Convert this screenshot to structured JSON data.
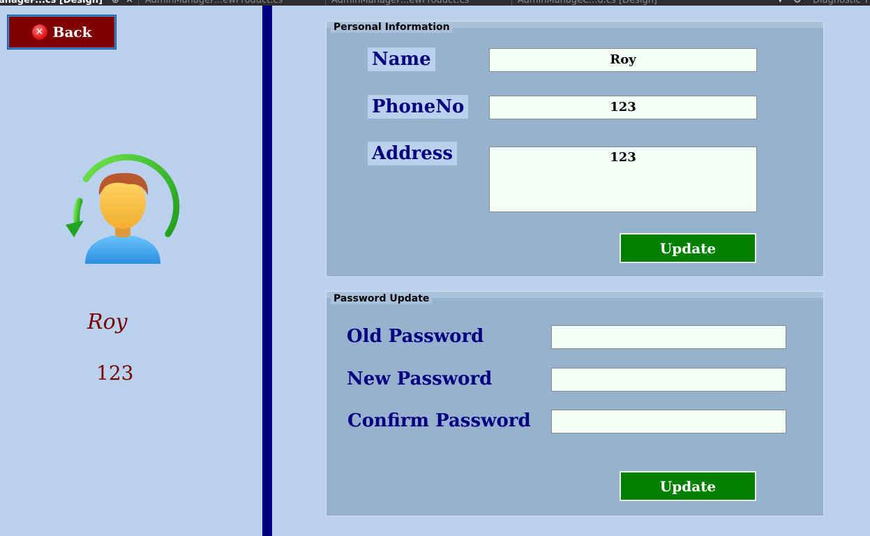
{
  "ide_tabs": [
    {
      "label": "anageP...cs [Design]",
      "active": true
    },
    {
      "label": "AdminManageP...ewProduct.cs",
      "active": false
    },
    {
      "label": "AdminManageP...ewProduct.cs",
      "active": false
    },
    {
      "label": "AdminManageC...d.cs [Design]",
      "active": false
    },
    {
      "label": "Diagnostic T",
      "active": false
    }
  ],
  "left_panel": {
    "back_label": "Back",
    "user_name": "Roy",
    "user_phone": "123"
  },
  "personal_info": {
    "title": "Personal Information",
    "name_label": "Name",
    "name_value": "Roy",
    "phone_label": "PhoneNo",
    "phone_value": "123",
    "address_label": "Address",
    "address_value": "123",
    "update_label": "Update"
  },
  "password_update": {
    "title": "Password Update",
    "old_label": "Old Password",
    "old_value": "",
    "new_label": "New Password",
    "new_value": "",
    "confirm_label": "Confirm Password",
    "confirm_value": "",
    "update_label": "Update"
  },
  "colors": {
    "background": "#b9d1ec",
    "groupbox": "#97b2cf",
    "label_text": "#00007f",
    "back_button": "#800000",
    "update_button": "#007f00",
    "splitter": "#00007f",
    "user_text": "#7a0000"
  },
  "icons": [
    "close-circle-icon",
    "user-refresh-icon",
    "pin-icon",
    "close-icon",
    "settings-icon"
  ]
}
